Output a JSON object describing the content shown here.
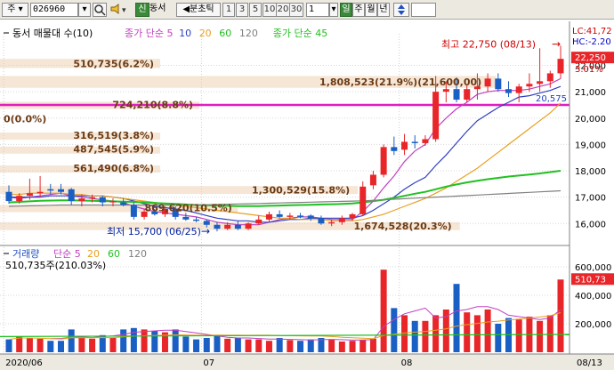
{
  "toolbar": {
    "period_prefix": "주",
    "code_value": "026960",
    "search_icon": "search-icon",
    "speaker_icon": "speaker-icon",
    "badge_label": "신",
    "stock_name": "동서",
    "interval_label": "◀분초틱",
    "interval_buttons": [
      "1",
      "3",
      "5",
      "10",
      "20",
      "30"
    ],
    "count_value": "1",
    "period_tabs": [
      "일",
      "주",
      "월",
      "년"
    ],
    "updown_icon": "updown-arrow-icon"
  },
  "colors": {
    "up": "#e8262a",
    "down": "#1a5fc4",
    "ma5": "#c040c0",
    "ma10": "#3040c0",
    "ma20": "#e8a020",
    "ma60": "#20c020",
    "ma120": "#808080",
    "highlight_line": "#e020c0",
    "band": "#f5e6d6"
  },
  "chart_data": {
    "type": "candlestick",
    "legend": {
      "prefix_icon": "dash-marker",
      "title": "동서 매물대 수(10)",
      "items": [
        {
          "label": "종가 단순 5",
          "color": "#c040c0"
        },
        {
          "label": "10",
          "color": "#3040c0"
        },
        {
          "label": "20",
          "color": "#e8a020"
        },
        {
          "label": "60",
          "color": "#20c020"
        },
        {
          "label": "120",
          "color": "#808080"
        },
        {
          "label": "종가 단순 45",
          "color": "#20c020"
        }
      ]
    },
    "y_ticks": [
      "22,000",
      "21,000",
      "20,000",
      "19,000",
      "18,000",
      "17,000",
      "16,000"
    ],
    "y_tick_values": [
      22000,
      21000,
      20000,
      19000,
      18000,
      17000,
      16000
    ],
    "price_range": [
      15300,
      23200
    ],
    "x_labels": [
      "2020/06",
      "07",
      "08",
      "08/13"
    ],
    "x_label_indices": [
      0,
      19,
      38,
      49
    ],
    "right_labels": {
      "lc": "LC:41,72",
      "hc": "HC:-2.20",
      "current_price": "22,250",
      "current_change": "3.01%",
      "ma_value": "20,575"
    },
    "annotations": {
      "high": "최고 22,750 (08/13)",
      "low": "최저 15,700 (06/25)",
      "level_line": 20500
    },
    "volume_profile": [
      {
        "label": "510,735(6.2%)",
        "price_lo": 21900,
        "price_hi": 22250
      },
      {
        "label": "1,808,523(21.9%)(21,600,00)",
        "price_lo": 21150,
        "price_hi": 21600
      },
      {
        "label": "724,210(8.8%)",
        "price_lo": 20400,
        "price_hi": 20620
      },
      {
        "label": "0(0.0%)",
        "price_lo": 19850,
        "price_hi": 20100
      },
      {
        "label": "316,519(3.8%)",
        "price_lo": 19250,
        "price_hi": 19450
      },
      {
        "label": "487,545(5.9%)",
        "price_lo": 18730,
        "price_hi": 18920
      },
      {
        "label": "561,490(6.8%)",
        "price_lo": 18000,
        "price_hi": 18200
      },
      {
        "label": "1,300,529(15.8%)",
        "price_lo": 17120,
        "price_hi": 17420
      },
      {
        "label": "869,620(10.5%)",
        "price_lo": 16500,
        "price_hi": 16700
      },
      {
        "label": "1,674,528(20.3%)",
        "price_lo": 15750,
        "price_hi": 16050
      }
    ],
    "candles": [
      {
        "o": 17200,
        "h": 17450,
        "l": 16750,
        "c": 16850
      },
      {
        "o": 16850,
        "h": 17150,
        "l": 16750,
        "c": 17050
      },
      {
        "o": 17050,
        "h": 17700,
        "l": 16900,
        "c": 17150
      },
      {
        "o": 17150,
        "h": 17800,
        "l": 17000,
        "c": 17200
      },
      {
        "o": 17300,
        "h": 17500,
        "l": 17100,
        "c": 17250
      },
      {
        "o": 17300,
        "h": 17500,
        "l": 17100,
        "c": 17200
      },
      {
        "o": 17300,
        "h": 17350,
        "l": 16700,
        "c": 16850
      },
      {
        "o": 16850,
        "h": 17100,
        "l": 16650,
        "c": 16950
      },
      {
        "o": 16950,
        "h": 17100,
        "l": 16800,
        "c": 17000
      },
      {
        "o": 17000,
        "h": 17050,
        "l": 16650,
        "c": 16800
      },
      {
        "o": 16800,
        "h": 16950,
        "l": 16650,
        "c": 16850
      },
      {
        "o": 16800,
        "h": 16950,
        "l": 16650,
        "c": 16700
      },
      {
        "o": 16700,
        "h": 16800,
        "l": 16150,
        "c": 16250
      },
      {
        "o": 16250,
        "h": 16550,
        "l": 16150,
        "c": 16450
      },
      {
        "o": 16450,
        "h": 16550,
        "l": 16300,
        "c": 16350
      },
      {
        "o": 16350,
        "h": 16650,
        "l": 16250,
        "c": 16550
      },
      {
        "o": 16550,
        "h": 16650,
        "l": 16150,
        "c": 16250
      },
      {
        "o": 16250,
        "h": 16400,
        "l": 16100,
        "c": 16150
      },
      {
        "o": 16150,
        "h": 16250,
        "l": 16050,
        "c": 16100
      },
      {
        "o": 16100,
        "h": 16150,
        "l": 15850,
        "c": 15950
      },
      {
        "o": 15950,
        "h": 16050,
        "l": 15700,
        "c": 15800
      },
      {
        "o": 15800,
        "h": 16050,
        "l": 15750,
        "c": 15950
      },
      {
        "o": 15950,
        "h": 16100,
        "l": 15750,
        "c": 15800
      },
      {
        "o": 15800,
        "h": 16050,
        "l": 15750,
        "c": 16000
      },
      {
        "o": 16000,
        "h": 16300,
        "l": 15950,
        "c": 16150
      },
      {
        "o": 16150,
        "h": 16450,
        "l": 16050,
        "c": 16350
      },
      {
        "o": 16350,
        "h": 16500,
        "l": 16200,
        "c": 16250
      },
      {
        "o": 16250,
        "h": 16400,
        "l": 16150,
        "c": 16300
      },
      {
        "o": 16300,
        "h": 16400,
        "l": 16200,
        "c": 16250
      },
      {
        "o": 16300,
        "h": 16350,
        "l": 16100,
        "c": 16200
      },
      {
        "o": 16200,
        "h": 16300,
        "l": 15950,
        "c": 16000
      },
      {
        "o": 16000,
        "h": 16150,
        "l": 15900,
        "c": 16050
      },
      {
        "o": 16050,
        "h": 16300,
        "l": 15950,
        "c": 16200
      },
      {
        "o": 16200,
        "h": 16400,
        "l": 16100,
        "c": 16350
      },
      {
        "o": 16350,
        "h": 17600,
        "l": 16300,
        "c": 17400
      },
      {
        "o": 17450,
        "h": 18000,
        "l": 17300,
        "c": 17850
      },
      {
        "o": 17850,
        "h": 19000,
        "l": 17750,
        "c": 18900
      },
      {
        "o": 18900,
        "h": 19300,
        "l": 18600,
        "c": 18750
      },
      {
        "o": 18800,
        "h": 19400,
        "l": 18600,
        "c": 19100
      },
      {
        "o": 19100,
        "h": 19350,
        "l": 18850,
        "c": 19050
      },
      {
        "o": 19050,
        "h": 19350,
        "l": 18950,
        "c": 19200
      },
      {
        "o": 19200,
        "h": 21600,
        "l": 19100,
        "c": 21000
      },
      {
        "o": 21000,
        "h": 21400,
        "l": 20600,
        "c": 21100
      },
      {
        "o": 21100,
        "h": 21550,
        "l": 20600,
        "c": 20700
      },
      {
        "o": 20700,
        "h": 21250,
        "l": 20600,
        "c": 21100
      },
      {
        "o": 21100,
        "h": 21700,
        "l": 20700,
        "c": 21200
      },
      {
        "o": 21200,
        "h": 21700,
        "l": 21000,
        "c": 21500
      },
      {
        "o": 21500,
        "h": 21700,
        "l": 21000,
        "c": 21100
      },
      {
        "o": 21100,
        "h": 21400,
        "l": 20800,
        "c": 20950
      },
      {
        "o": 20950,
        "h": 21300,
        "l": 20600,
        "c": 21200
      },
      {
        "o": 21200,
        "h": 21700,
        "l": 21000,
        "c": 21300
      },
      {
        "o": 21300,
        "h": 22650,
        "l": 21000,
        "c": 21400
      },
      {
        "o": 21400,
        "h": 21800,
        "l": 21150,
        "c": 21700
      },
      {
        "o": 21700,
        "h": 22750,
        "l": 21500,
        "c": 22250
      }
    ],
    "ma_lines": [
      {
        "name": "5",
        "color": "#c040c0",
        "values": [
          17000,
          16950,
          17000,
          17050,
          17100,
          17150,
          17050,
          17000,
          16950,
          16900,
          16850,
          16800,
          16650,
          16550,
          16450,
          16400,
          16350,
          16300,
          16250,
          16150,
          16050,
          16000,
          15950,
          15950,
          15950,
          16050,
          16150,
          16200,
          16250,
          16250,
          16200,
          16150,
          16150,
          16150,
          16450,
          16850,
          17350,
          17800,
          18350,
          18750,
          19000,
          19600,
          20000,
          20350,
          20600,
          20900,
          21000,
          21050,
          21050,
          21050,
          21100,
          21200,
          21300,
          21500
        ]
      },
      {
        "name": "10",
        "color": "#3040c0",
        "values": [
          17000,
          17000,
          17000,
          17000,
          17050,
          17050,
          17050,
          17050,
          17050,
          17050,
          17000,
          16950,
          16850,
          16750,
          16650,
          16600,
          16550,
          16500,
          16400,
          16300,
          16200,
          16150,
          16100,
          16100,
          16050,
          16050,
          16100,
          16150,
          16150,
          16200,
          16200,
          16200,
          16200,
          16200,
          16300,
          16500,
          16750,
          17000,
          17300,
          17550,
          17750,
          18200,
          18600,
          19050,
          19500,
          19900,
          20150,
          20400,
          20600,
          20800,
          20850,
          20950,
          21050,
          21200
        ]
      },
      {
        "name": "20",
        "color": "#e8a020",
        "values": [
          17100,
          17100,
          17150,
          17150,
          17150,
          17150,
          17100,
          17100,
          17050,
          17050,
          17000,
          16950,
          16900,
          16850,
          16800,
          16750,
          16700,
          16650,
          16600,
          16550,
          16500,
          16450,
          16400,
          16350,
          16300,
          16250,
          16200,
          16200,
          16150,
          16150,
          16150,
          16100,
          16100,
          16100,
          16150,
          16250,
          16350,
          16500,
          16650,
          16800,
          16950,
          17150,
          17350,
          17600,
          17850,
          18100,
          18400,
          18700,
          19000,
          19300,
          19600,
          19900,
          20200,
          20575
        ]
      },
      {
        "name": "60",
        "color": "#20c020",
        "values": [
          16800,
          16820,
          16840,
          16860,
          16870,
          16880,
          16880,
          16870,
          16860,
          16850,
          16840,
          16830,
          16820,
          16800,
          16780,
          16760,
          16740,
          16720,
          16700,
          16690,
          16680,
          16670,
          16660,
          16660,
          16660,
          16670,
          16680,
          16690,
          16700,
          16710,
          16720,
          16730,
          16740,
          16760,
          16800,
          16850,
          16900,
          16970,
          17050,
          17130,
          17200,
          17300,
          17400,
          17480,
          17560,
          17620,
          17680,
          17730,
          17780,
          17820,
          17860,
          17900,
          17950,
          18000
        ]
      },
      {
        "name": "120",
        "color": "#808080",
        "values": [
          16650,
          16660,
          16670,
          16680,
          16690,
          16700,
          16700,
          16700,
          16700,
          16700,
          16700,
          16700,
          16700,
          16700,
          16700,
          16700,
          16700,
          16700,
          16700,
          16710,
          16720,
          16730,
          16740,
          16750,
          16760,
          16770,
          16780,
          16790,
          16800,
          16810,
          16820,
          16830,
          16840,
          16850,
          16860,
          16880,
          16900,
          16920,
          16940,
          16960,
          16980,
          17000,
          17020,
          17040,
          17060,
          17080,
          17100,
          17120,
          17140,
          17160,
          17180,
          17200,
          17220,
          17240
        ]
      }
    ],
    "volume": {
      "legend_title": "거래량",
      "legend_items": [
        {
          "label": "단순 5",
          "color": "#c040c0"
        },
        {
          "label": "20",
          "color": "#e8a020"
        },
        {
          "label": "60",
          "color": "#20c020"
        },
        {
          "label": "120",
          "color": "#808080"
        }
      ],
      "current_label": "510,735주(210.03%)",
      "right_current": "510,73",
      "y_ticks": [
        "600,000",
        "400,000",
        "200,000"
      ],
      "y_tick_values": [
        600000,
        400000,
        200000
      ],
      "range": [
        0,
        650000
      ],
      "values": [
        90000,
        110000,
        100000,
        95000,
        80000,
        80000,
        160000,
        100000,
        95000,
        120000,
        100000,
        160000,
        170000,
        160000,
        150000,
        140000,
        160000,
        110000,
        90000,
        100000,
        120000,
        95000,
        100000,
        90000,
        90000,
        80000,
        100000,
        85000,
        80000,
        90000,
        100000,
        90000,
        75000,
        80000,
        85000,
        95000,
        580000,
        310000,
        260000,
        220000,
        220000,
        260000,
        300000,
        480000,
        280000,
        260000,
        300000,
        200000,
        240000,
        230000,
        250000,
        220000,
        260000,
        510735
      ],
      "ma5": [
        null,
        null,
        null,
        null,
        95000,
        97000,
        105000,
        107000,
        103000,
        110000,
        115000,
        125000,
        140000,
        145000,
        150000,
        155000,
        155000,
        145000,
        135000,
        125000,
        115000,
        105000,
        100000,
        100000,
        96000,
        92000,
        92000,
        90000,
        88000,
        86000,
        88000,
        90000,
        88000,
        85000,
        86000,
        88000,
        180000,
        230000,
        270000,
        290000,
        310000,
        240000,
        250000,
        290000,
        300000,
        320000,
        320000,
        300000,
        260000,
        250000,
        240000,
        230000,
        240000,
        300000
      ]
    }
  }
}
